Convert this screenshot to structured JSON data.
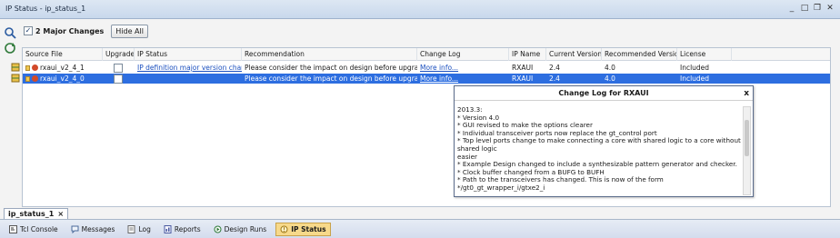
{
  "window": {
    "title": "IP Status - ip_status_1",
    "controls": [
      "_",
      "□",
      "❐",
      "✕"
    ]
  },
  "toolbar": {
    "major_changes_label": "2 Major Changes",
    "hide_all_label": "Hide All",
    "major_changes_checked": true
  },
  "grid": {
    "columns": [
      "Source File",
      "Upgrade",
      "IP Status",
      "Recommendation",
      "Change Log",
      "IP Name",
      "Current Version",
      "Recommended Version",
      "License"
    ],
    "rows": [
      {
        "source_file": "rxaui_v2_4_1",
        "upgrade": false,
        "ip_status": "IP definition major version change.",
        "recommendation": "Please consider the impact on design before upgrading the IP.",
        "change_log": "More info...",
        "ip_name": "RXAUI",
        "current_version": "2.4",
        "recommended_version": "4.0",
        "license": "Included",
        "selected": false
      },
      {
        "source_file": "rxaui_v2_4_0",
        "upgrade": false,
        "ip_status": "",
        "recommendation": "Please consider the impact on design before upgrading the IP.",
        "change_log": "More info...",
        "ip_name": "RXAUI",
        "current_version": "2.4",
        "recommended_version": "4.0",
        "license": "Included",
        "selected": true
      }
    ]
  },
  "popup": {
    "title": "Change Log for RXAUI",
    "close": "x",
    "lines": [
      "2013.3:",
      " * Version 4.0",
      " * GUI revised to make the options clearer",
      " * Individual transceiver ports now replace the gt_control port",
      " * Top level ports change to make connecting a core with shared logic to a core without shared logic",
      "easier",
      " * Example Design changed to include a synthesizable pattern generator and checker.",
      " * Clock buffer changed from a BUFG to BUFH",
      " * Path to the transceivers has changed. This is now of the form */gt0_gt_wrapper_i/gtxe2_i"
    ]
  },
  "tabs": {
    "ip_status_tab": "ip_status_1",
    "ip_status_close": "×"
  },
  "bottom_tabs": [
    {
      "label": "Tcl Console",
      "icon": "console-icon",
      "active": false
    },
    {
      "label": "Messages",
      "icon": "messages-icon",
      "active": false
    },
    {
      "label": "Log",
      "icon": "log-icon",
      "active": false
    },
    {
      "label": "Reports",
      "icon": "reports-icon",
      "active": false
    },
    {
      "label": "Design Runs",
      "icon": "design-runs-icon",
      "active": false
    },
    {
      "label": "IP Status",
      "icon": "ip-status-icon",
      "active": true
    }
  ],
  "colors": {
    "selection": "#2d6ee0",
    "link": "#1a4fbf",
    "active_tab": "#f7d98a"
  }
}
